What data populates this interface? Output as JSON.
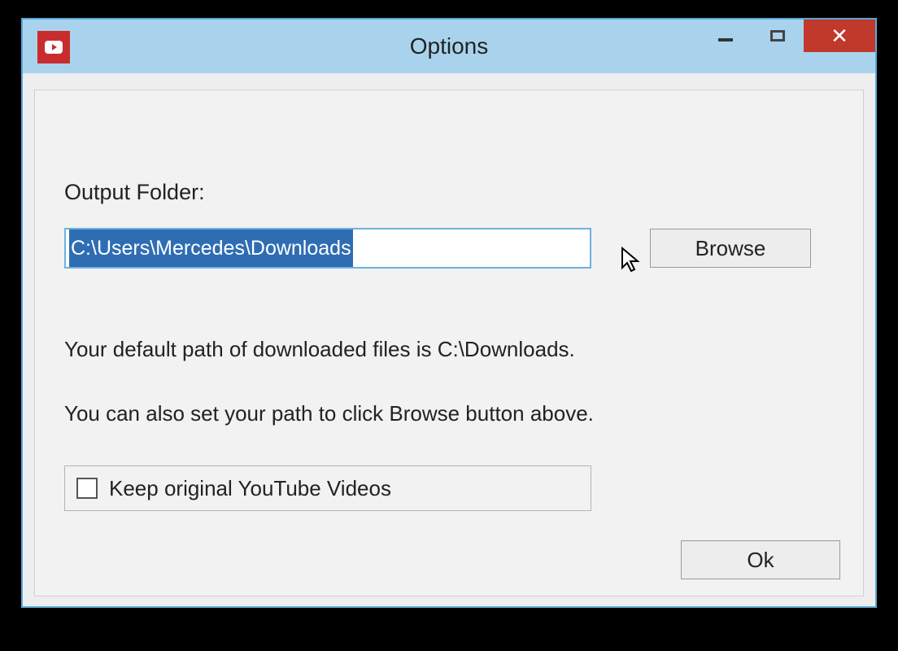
{
  "window": {
    "title": "Options",
    "icon": "youtube-icon"
  },
  "controls": {
    "minimize": "minimize",
    "maximize": "maximize",
    "close": "close"
  },
  "form": {
    "output_folder_label": "Output Folder:",
    "path_value": "C:\\Users\\Mercedes\\Downloads",
    "browse_label": "Browse",
    "hint1": "Your default path of downloaded files is C:\\Downloads.",
    "hint2": "You can also set your path to click Browse button above.",
    "checkbox_label": "Keep original YouTube Videos",
    "checkbox_checked": false,
    "ok_label": "Ok"
  }
}
